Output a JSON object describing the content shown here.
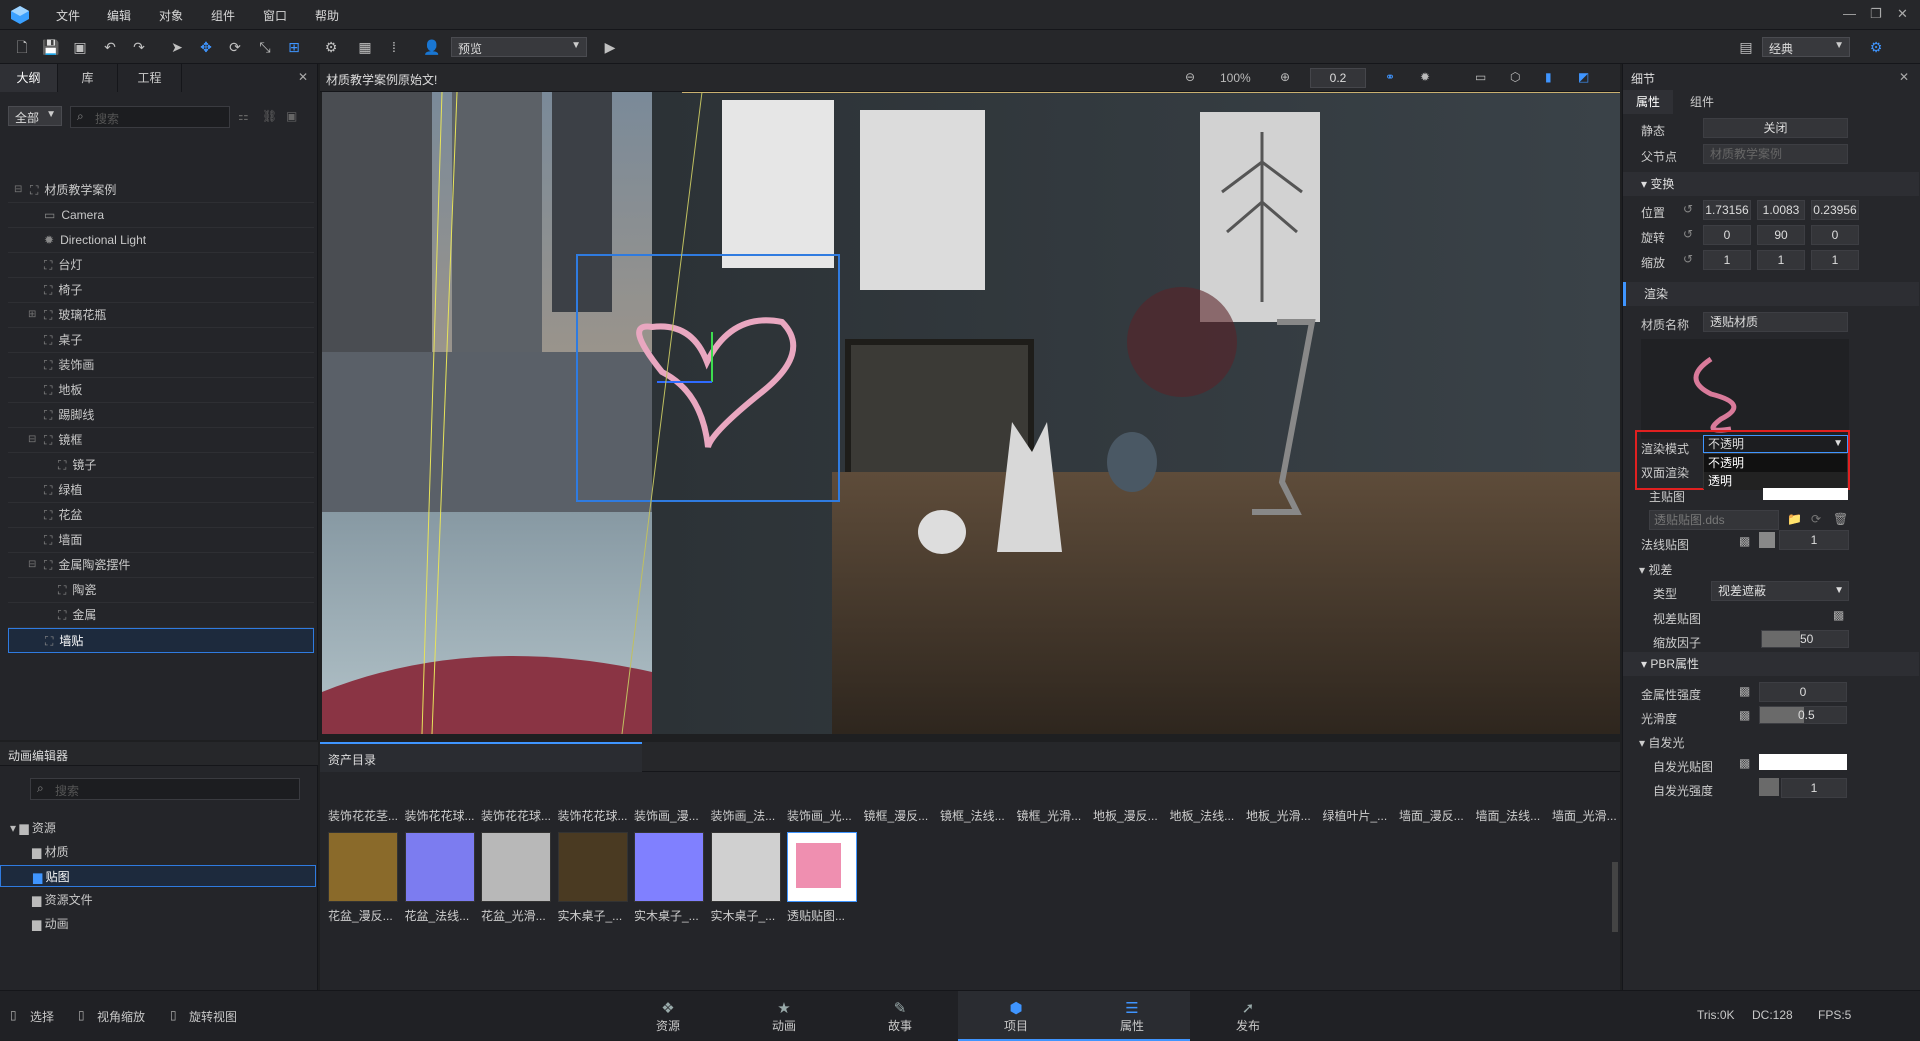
{
  "menu": [
    "文件",
    "编辑",
    "对象",
    "组件",
    "窗口",
    "帮助"
  ],
  "toolbar": {
    "view_mode": "预览",
    "layout": "经典"
  },
  "left_panel": {
    "tabs": [
      "大纲",
      "库",
      "工程"
    ],
    "filter": "全部",
    "search_placeholder": "搜索",
    "tree": [
      "材质教学案例",
      "Camera",
      "Directional Light",
      "台灯",
      "椅子",
      "玻璃花瓶",
      "桌子",
      "装饰画",
      "地板",
      "踢脚线",
      "镜框",
      "镜子",
      "绿植",
      "花盆",
      "墙面",
      "金属陶瓷摆件",
      "陶瓷",
      "金属",
      "墙贴"
    ]
  },
  "viewport": {
    "title": "材质教学案例原始文!",
    "zoom": "100%",
    "step": "0.2"
  },
  "right_panel": {
    "title": "细节",
    "tabs": [
      "属性",
      "组件"
    ],
    "static_label": "静态",
    "static_value": "关闭",
    "parent_label": "父节点",
    "parent_value": "材质教学案例",
    "transform_label": "变换",
    "position_label": "位置",
    "position": [
      "1.73156",
      "1.0083",
      "0.23956"
    ],
    "rotation_label": "旋转",
    "rotation": [
      "0",
      "90",
      "0"
    ],
    "scale_label": "缩放",
    "scale": [
      "1",
      "1",
      "1"
    ],
    "render_label": "渲染",
    "material_name_label": "材质名称",
    "material_name": "透贴材质",
    "render_mode_label": "渲染模式",
    "render_mode": "不透明",
    "render_mode_options": [
      "不透明",
      "透明"
    ],
    "double_side_label": "双面渲染",
    "main_map_label": "主贴图",
    "main_map_file": "透贴贴图.dds",
    "normal_map_label": "法线贴图",
    "normal_value": "1",
    "parallax_label": "视差",
    "type_label": "类型",
    "type_value": "视差遮蔽",
    "parallax_map_label": "视差贴图",
    "scale_factor_label": "缩放因子",
    "scale_factor": "50",
    "pbr_label": "PBR属性",
    "metal_label": "金属性强度",
    "metal_value": "0",
    "smooth_label": "光滑度",
    "smooth_value": "0.5",
    "emissive_label": "自发光",
    "emissive_map_label": "自发光贴图",
    "emissive_strength_label": "自发光强度",
    "emissive_strength": "1"
  },
  "anim_panel": {
    "title": "动画编辑器",
    "search_placeholder": "搜索",
    "folders": [
      "资源",
      "材质",
      "贴图",
      "资源文件",
      "动画"
    ]
  },
  "assets_panel": {
    "title": "资产目录",
    "top_row": [
      "装饰花花茎...",
      "装饰花花球...",
      "装饰花花球...",
      "装饰花花球...",
      "装饰画_漫...",
      "装饰画_法...",
      "装饰画_光...",
      "镜框_漫反...",
      "镜框_法线...",
      "镜框_光滑...",
      "地板_漫反...",
      "地板_法线...",
      "地板_光滑...",
      "绿植叶片_...",
      "墙面_漫反...",
      "墙面_法线...",
      "墙面_光滑..."
    ],
    "thumbs": [
      "花盆_漫反...",
      "花盆_法线...",
      "花盆_光滑...",
      "实木桌子_...",
      "实木桌子_...",
      "实木桌子_...",
      "透贴贴图..."
    ]
  },
  "statusbar": {
    "tools": [
      "选择",
      "视角缩放",
      "旋转视图"
    ],
    "nav": [
      "资源",
      "动画",
      "故事",
      "项目",
      "属性",
      "发布"
    ],
    "tris": "Tris:0K",
    "dc": "DC:128",
    "fps": "FPS:5"
  }
}
